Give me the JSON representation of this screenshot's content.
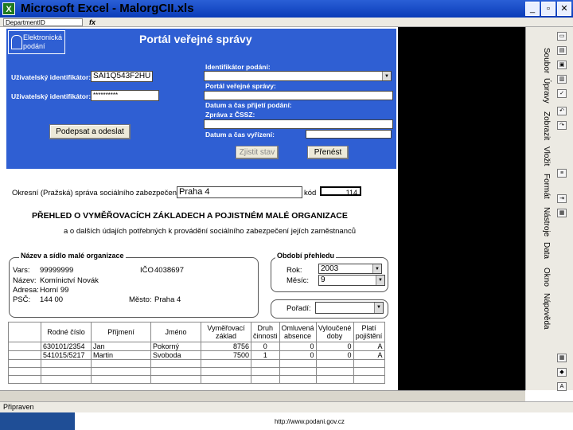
{
  "window": {
    "title": "Microsoft Excel - MalorgCII.xls",
    "app_icon": "X",
    "minimize": "_",
    "restore": "▫",
    "close": "✕"
  },
  "formula_bar": {
    "name_box": "DepartmentID",
    "fx": "fx"
  },
  "portal": {
    "logo_line1": "Elektronická",
    "logo_line2": "podání",
    "title": "Portál veřejné správy",
    "user_id1_label": "Uživatelský identifikátor:",
    "user_id1_value": "SAI1Q543F2HU",
    "user_id2_label": "Uživatelský identifikátor:",
    "user_id2_value": "**********",
    "submit_button": "Podepsat a odeslat",
    "submission_id_label": "Identifikátor podání:",
    "portal_label": "Portál veřejné správy:",
    "received_label": "Datum a čas přijetí podání:",
    "cssz_label": "Zpráva z ČSSZ:",
    "settled_label": "Datum a čas vyřízení:",
    "status_button": "Zjistit stav",
    "transfer_button": "Přenést"
  },
  "form": {
    "office_label": "Okresní (Pražská) správa sociálního zabezpečení",
    "office_value": "Praha 4",
    "code_suffix": "kód",
    "code_value": "114",
    "heading1": "PŘEHLED O VYMĚŘOVACÍCH ZÁKLADECH A POJISTNÉM MALÉ ORGANIZACE",
    "heading2": "a o dalších údajích potřebných k provádění sociálního zabezpečení jejích zaměstnanců",
    "org_group_title": "Název a sídlo malé organizace",
    "vs_label": "Vars:",
    "vs_value": "99999999",
    "ico_label": "IČO",
    "ico_value": "4038697",
    "name_label": "Název:",
    "name_value": "Komínictví Novák",
    "address_label": "Adresa:",
    "address_value": "Horní 99",
    "psc_label": "PSČ:",
    "psc_value": "144 00",
    "city_label": "Město:",
    "city_value": "Praha 4",
    "period_group_title": "Období přehledu",
    "year_label": "Rok:",
    "year_value": "2003",
    "month_label": "Měsíc:",
    "month_value": "9",
    "order_label": "Pořadí:",
    "order_value": ""
  },
  "table": {
    "headers": [
      "Rodné číslo",
      "Příjmení",
      "Jméno",
      "Vyměřovací základ",
      "Druh činnosti",
      "Omluvená absence",
      "Vyloučené doby",
      "Platí pojištění"
    ],
    "rows": [
      [
        "630101/2354",
        "Jan",
        "Pokorný",
        "8756",
        "0",
        "0",
        "0",
        "A"
      ],
      [
        "541015/5217",
        "Martin",
        "Svoboda",
        "7500",
        "1",
        "0",
        "0",
        "A"
      ]
    ]
  },
  "task_pane": {
    "tabs": [
      "Soubor",
      "Úpravy",
      "Zobrazit",
      "Vložit",
      "Formát",
      "Nástroje",
      "Data",
      "Okno",
      "Nápověda"
    ]
  },
  "status": {
    "text": "Připraven"
  },
  "footer": {
    "url": "http://www.podani.gov.cz"
  }
}
